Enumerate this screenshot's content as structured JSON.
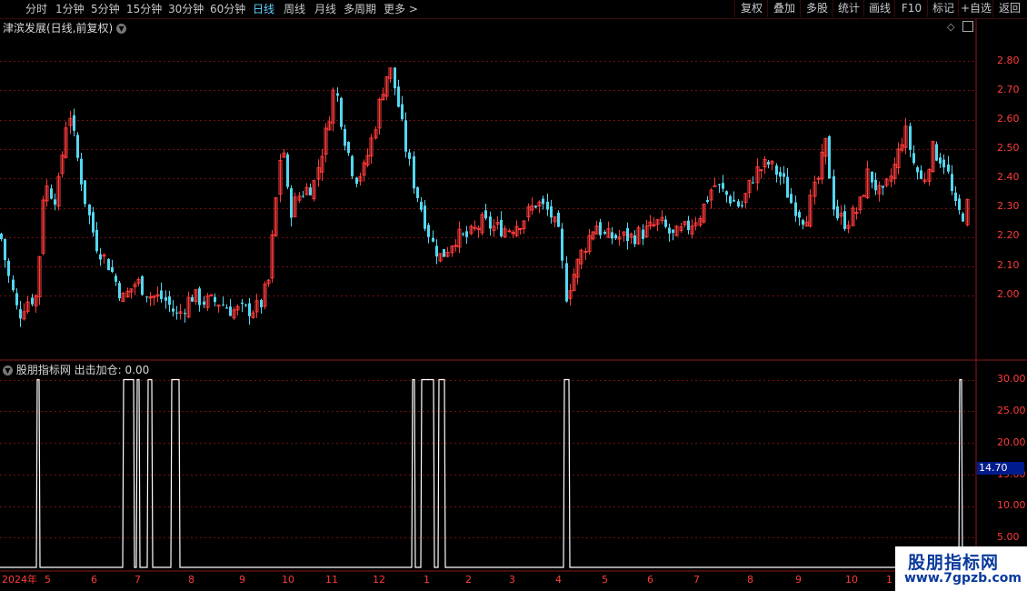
{
  "toolbar": {
    "periods": [
      {
        "label": "分时",
        "active": false
      },
      {
        "label": "1分钟",
        "active": false
      },
      {
        "label": "5分钟",
        "active": false
      },
      {
        "label": "15分钟",
        "active": false
      },
      {
        "label": "30分钟",
        "active": false
      },
      {
        "label": "60分钟",
        "active": false
      },
      {
        "label": "日线",
        "active": true
      },
      {
        "label": "周线",
        "active": false
      },
      {
        "label": "月线",
        "active": false
      },
      {
        "label": "多周期",
        "active": false
      },
      {
        "label": "更多 >",
        "active": false
      }
    ],
    "right_buttons": [
      "复权",
      "叠加",
      "多股",
      "统计",
      "画线",
      "F10",
      "标记",
      "+自选",
      "返回"
    ]
  },
  "main_panel": {
    "title": "津滨发展(日线,前复权)",
    "price_ticks": [
      "2.80",
      "2.70",
      "2.60",
      "2.50",
      "2.40",
      "2.30",
      "2.20",
      "2.10",
      "2.00"
    ]
  },
  "indicator_panel": {
    "title": "股朋指标网 出击加仓: 0.00",
    "value_ticks": [
      "30.00",
      "25.00",
      "20.00",
      "15.00",
      "10.00",
      "5.00"
    ],
    "current_value_badge": "14.70"
  },
  "date_axis": {
    "labels": [
      "2024年",
      "5",
      "6",
      "7",
      "8",
      "9",
      "10",
      "11",
      "12",
      "1",
      "2",
      "3",
      "4",
      "5",
      "6",
      "7",
      "8",
      "9",
      "10",
      "1"
    ]
  },
  "watermark": {
    "title": "股朋指标网",
    "url": "www.7gpzb.com"
  },
  "colors": {
    "up": "#ff3b3b",
    "down": "#54d7f0",
    "grid": "#6e1010",
    "signal": "#ffffff",
    "active_tab": "#5fd3ff"
  },
  "chart_data": [
    {
      "type": "candlestick",
      "title": "津滨发展(日线,前复权)",
      "y_ticks": [
        2.0,
        2.1,
        2.2,
        2.3,
        2.4,
        2.5,
        2.6,
        2.7,
        2.8
      ],
      "ylim": [
        1.9,
        2.88
      ],
      "x_tick_labels": [
        "2024年",
        "5",
        "6",
        "7",
        "8",
        "9",
        "10",
        "11",
        "12",
        "1",
        "2",
        "3",
        "4",
        "5",
        "6",
        "7",
        "8",
        "9",
        "10",
        "1"
      ],
      "close_path": [
        [
          0,
          2.21
        ],
        [
          8,
          2.08
        ],
        [
          20,
          1.93
        ],
        [
          28,
          1.98
        ],
        [
          40,
          2.0
        ],
        [
          48,
          2.38
        ],
        [
          62,
          2.33
        ],
        [
          75,
          2.65
        ],
        [
          80,
          2.55
        ],
        [
          95,
          2.3
        ],
        [
          105,
          2.18
        ],
        [
          120,
          2.1
        ],
        [
          135,
          1.99
        ],
        [
          150,
          2.05
        ],
        [
          165,
          2.0
        ],
        [
          180,
          1.99
        ],
        [
          195,
          1.93
        ],
        [
          210,
          2.0
        ],
        [
          225,
          1.98
        ],
        [
          240,
          1.98
        ],
        [
          255,
          1.95
        ],
        [
          270,
          1.95
        ],
        [
          285,
          1.96
        ],
        [
          295,
          2.05
        ],
        [
          305,
          2.38
        ],
        [
          310,
          2.55
        ],
        [
          318,
          2.28
        ],
        [
          330,
          2.35
        ],
        [
          345,
          2.38
        ],
        [
          358,
          2.55
        ],
        [
          368,
          2.72
        ],
        [
          378,
          2.55
        ],
        [
          390,
          2.4
        ],
        [
          400,
          2.43
        ],
        [
          410,
          2.55
        ],
        [
          420,
          2.7
        ],
        [
          428,
          2.78
        ],
        [
          436,
          2.68
        ],
        [
          445,
          2.52
        ],
        [
          455,
          2.38
        ],
        [
          465,
          2.28
        ],
        [
          475,
          2.18
        ],
        [
          485,
          2.13
        ],
        [
          500,
          2.2
        ],
        [
          515,
          2.2
        ],
        [
          530,
          2.25
        ],
        [
          545,
          2.23
        ],
        [
          560,
          2.23
        ],
        [
          575,
          2.26
        ],
        [
          590,
          2.32
        ],
        [
          605,
          2.28
        ],
        [
          615,
          2.2
        ],
        [
          622,
          2.0
        ],
        [
          628,
          2.05
        ],
        [
          640,
          2.15
        ],
        [
          655,
          2.25
        ],
        [
          665,
          2.2
        ],
        [
          680,
          2.2
        ],
        [
          695,
          2.2
        ],
        [
          710,
          2.22
        ],
        [
          725,
          2.25
        ],
        [
          740,
          2.2
        ],
        [
          755,
          2.23
        ],
        [
          770,
          2.28
        ],
        [
          785,
          2.38
        ],
        [
          800,
          2.34
        ],
        [
          815,
          2.3
        ],
        [
          830,
          2.42
        ],
        [
          845,
          2.45
        ],
        [
          860,
          2.4
        ],
        [
          870,
          2.32
        ],
        [
          885,
          2.26
        ],
        [
          900,
          2.4
        ],
        [
          908,
          2.52
        ],
        [
          918,
          2.28
        ],
        [
          930,
          2.25
        ],
        [
          945,
          2.3
        ],
        [
          955,
          2.42
        ],
        [
          970,
          2.33
        ],
        [
          985,
          2.45
        ],
        [
          995,
          2.57
        ],
        [
          1005,
          2.45
        ],
        [
          1015,
          2.38
        ],
        [
          1025,
          2.5
        ],
        [
          1040,
          2.45
        ],
        [
          1050,
          2.3
        ],
        [
          1058,
          2.27
        ],
        [
          1066,
          2.32
        ]
      ]
    },
    {
      "type": "line",
      "title": "股朋指标网",
      "series_label": "出击加仓",
      "current_value": 0.0,
      "y_ticks": [
        5,
        10,
        15,
        20,
        25,
        30
      ],
      "ylim": [
        0,
        32
      ],
      "pulses_at_30": [
        [
          40,
          43
        ],
        [
          135,
          147
        ],
        [
          150,
          153
        ],
        [
          162,
          167
        ],
        [
          188,
          197
        ],
        [
          453,
          456
        ],
        [
          463,
          477
        ],
        [
          482,
          489
        ],
        [
          620,
          626
        ],
        [
          1055,
          1058
        ]
      ]
    }
  ]
}
